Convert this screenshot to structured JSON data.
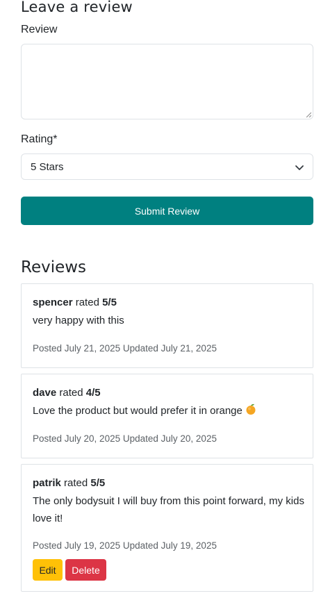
{
  "form": {
    "heading": "Leave a review",
    "review_label": "Review",
    "review_value": "",
    "rating_label": "Rating*",
    "rating_selected": "5 Stars",
    "submit_label": "Submit Review"
  },
  "reviews_heading": "Reviews",
  "reviews": [
    {
      "author": "spencer",
      "rated_text": "rated",
      "rating": "5/5",
      "text": "very happy with this",
      "posted": "Posted July 21, 2025",
      "updated": "Updated July 21, 2025"
    },
    {
      "author": "dave",
      "rated_text": "rated",
      "rating": "4/5",
      "text": "Love the product but would prefer it in orange",
      "emoji": "orange-fruit-icon",
      "posted": "Posted July 20, 2025",
      "updated": "Updated July 20, 2025"
    },
    {
      "author": "patrik",
      "rated_text": "rated",
      "rating": "5/5",
      "text": "The only bodysuit I will buy from this point forward, my kids love it!",
      "posted": "Posted July 19, 2025",
      "updated": "Updated July 19, 2025",
      "actions": {
        "edit_label": "Edit",
        "delete_label": "Delete"
      }
    }
  ],
  "colors": {
    "primary": "#008080",
    "warning": "#ffc107",
    "danger": "#dc3545",
    "border": "#dee2e6",
    "muted": "#5c6166"
  }
}
